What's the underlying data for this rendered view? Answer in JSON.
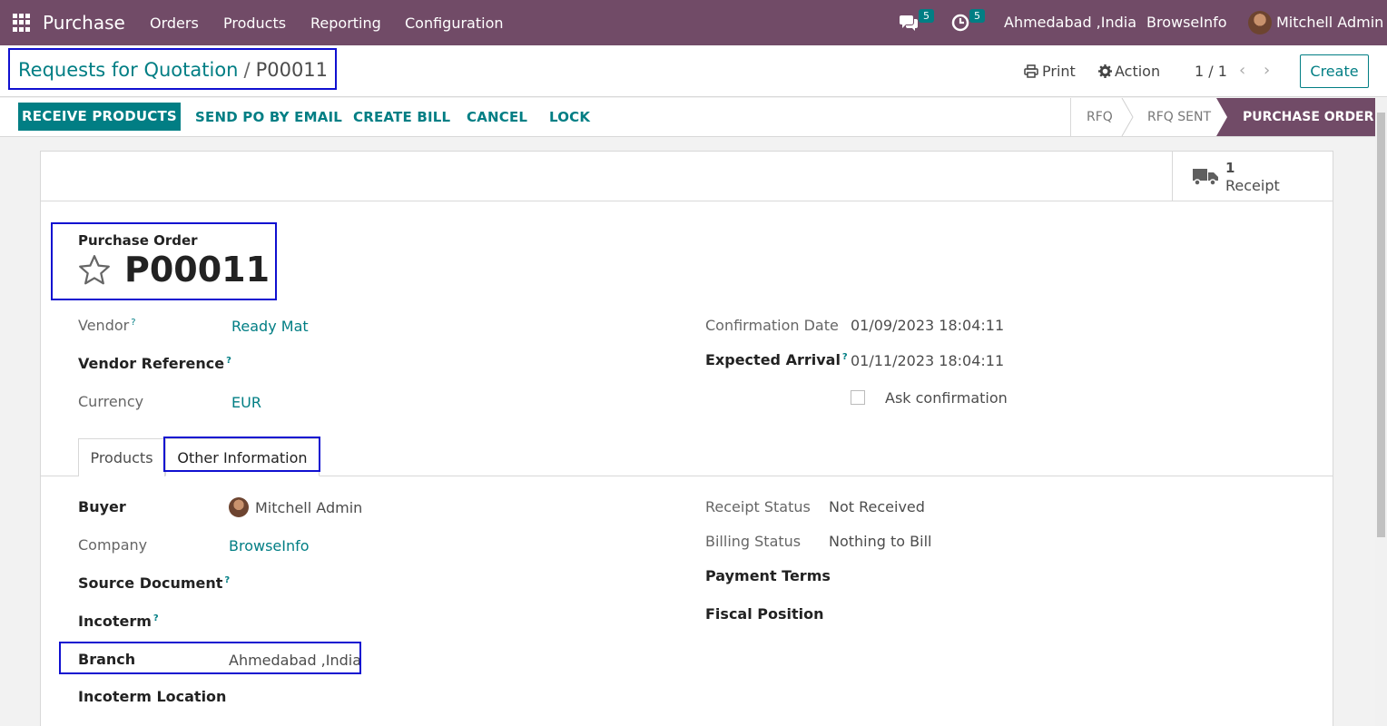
{
  "navbar": {
    "app_name": "Purchase",
    "menu": [
      "Orders",
      "Products",
      "Reporting",
      "Configuration"
    ],
    "messages_count": "5",
    "activities_count": "5",
    "branch": "Ahmedabad ,India",
    "company": "BrowseInfo",
    "user": "Mitchell Admin"
  },
  "control_panel": {
    "breadcrumb_parent": "Requests for Quotation",
    "breadcrumb_sep": "/",
    "breadcrumb_current": "P00011",
    "print_label": "Print",
    "action_label": "Action",
    "pager": "1 / 1",
    "create_label": "Create"
  },
  "statusbar": {
    "buttons": [
      "RECEIVE PRODUCTS",
      "SEND PO BY EMAIL",
      "CREATE BILL",
      "CANCEL",
      "LOCK"
    ],
    "stages": [
      "RFQ",
      "RFQ SENT",
      "PURCHASE ORDER"
    ],
    "active_stage": "PURCHASE ORDER"
  },
  "smart_button": {
    "count": "1",
    "label": "Receipt",
    "icon": "truck-icon"
  },
  "record": {
    "title_label": "Purchase Order",
    "name": "P00011",
    "fields_left": [
      {
        "label": "Vendor",
        "help": "?",
        "value": "Ready Mat"
      },
      {
        "label": "Vendor Reference",
        "help": "?",
        "value": ""
      },
      {
        "label": "Currency",
        "value": "EUR"
      }
    ],
    "fields_right": [
      {
        "label": "Confirmation Date",
        "value": "01/09/2023 18:04:11"
      },
      {
        "label": "Expected Arrival",
        "help": "?",
        "value": "01/11/2023 18:04:11"
      },
      {
        "label": "Ask confirmation",
        "checked": false
      }
    ]
  },
  "tabs": {
    "products": "Products",
    "other": "Other Information",
    "active": "Other Information"
  },
  "other_info": {
    "left": [
      {
        "label": "Buyer",
        "value": "Mitchell Admin"
      },
      {
        "label": "Company",
        "value": "BrowseInfo"
      },
      {
        "label": "Source Document",
        "help": "?",
        "value": ""
      },
      {
        "label": "Incoterm",
        "help": "?",
        "value": ""
      },
      {
        "label": "Branch",
        "value": "Ahmedabad ,India"
      },
      {
        "label": "Incoterm Location",
        "value": ""
      }
    ],
    "right": [
      {
        "label": "Receipt Status",
        "value": "Not Received"
      },
      {
        "label": "Billing Status",
        "value": "Nothing to Bill"
      },
      {
        "label": "Payment Terms",
        "value": ""
      },
      {
        "label": "Fiscal Position",
        "value": ""
      }
    ]
  },
  "colors": {
    "brand": "#714b67",
    "accent": "#017e84",
    "highlight": "#1010d0"
  }
}
